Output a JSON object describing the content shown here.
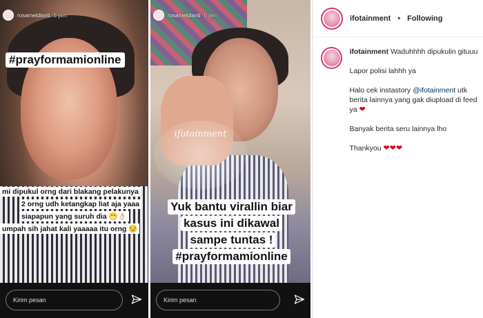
{
  "stories": [
    {
      "username": "rosameldianti",
      "time": "5 jam",
      "hashtag": "#prayformamionline",
      "caption_lines": [
        "mi dipukul orng dari blakang pelakunya",
        "2 orng udh ketangkap liat aja yaaa",
        "siapapun yang suruh dia 😁👌🏻",
        "umpah sih jahat kali yaaaaa itu orng 😒"
      ],
      "message_placeholder": "Kirim pesan",
      "send_icon": "paper-plane-icon"
    },
    {
      "username": "rosameldianti",
      "time": "5 jam",
      "watermark": "ifotainment",
      "caption_lines": [
        "Yuk bantu virallin biar",
        "kasus ini dikawal",
        "sampe tuntas !",
        "#prayformamionline"
      ],
      "message_placeholder": "Kirim pesan",
      "send_icon": "paper-plane-icon"
    }
  ],
  "post": {
    "username": "ifotainment",
    "separator": "•",
    "follow_status": "Following",
    "caption": {
      "username": "ifotainment",
      "intro": "Waduhhhh dipukulin gituuu",
      "line_report": "Lapor polisi lahhh ya",
      "line_check_prefix": "Halo cek instastory ",
      "mention": "@ifotainment",
      "line_check_suffix": " utk berita lainnya yang gak diupload di feed ya",
      "line_more": "Banyak berita seru lainnya lho",
      "line_thanks": "Thankyou",
      "heart": "❤",
      "accent_color": "#e1306c",
      "mention_color": "#00376b"
    }
  }
}
